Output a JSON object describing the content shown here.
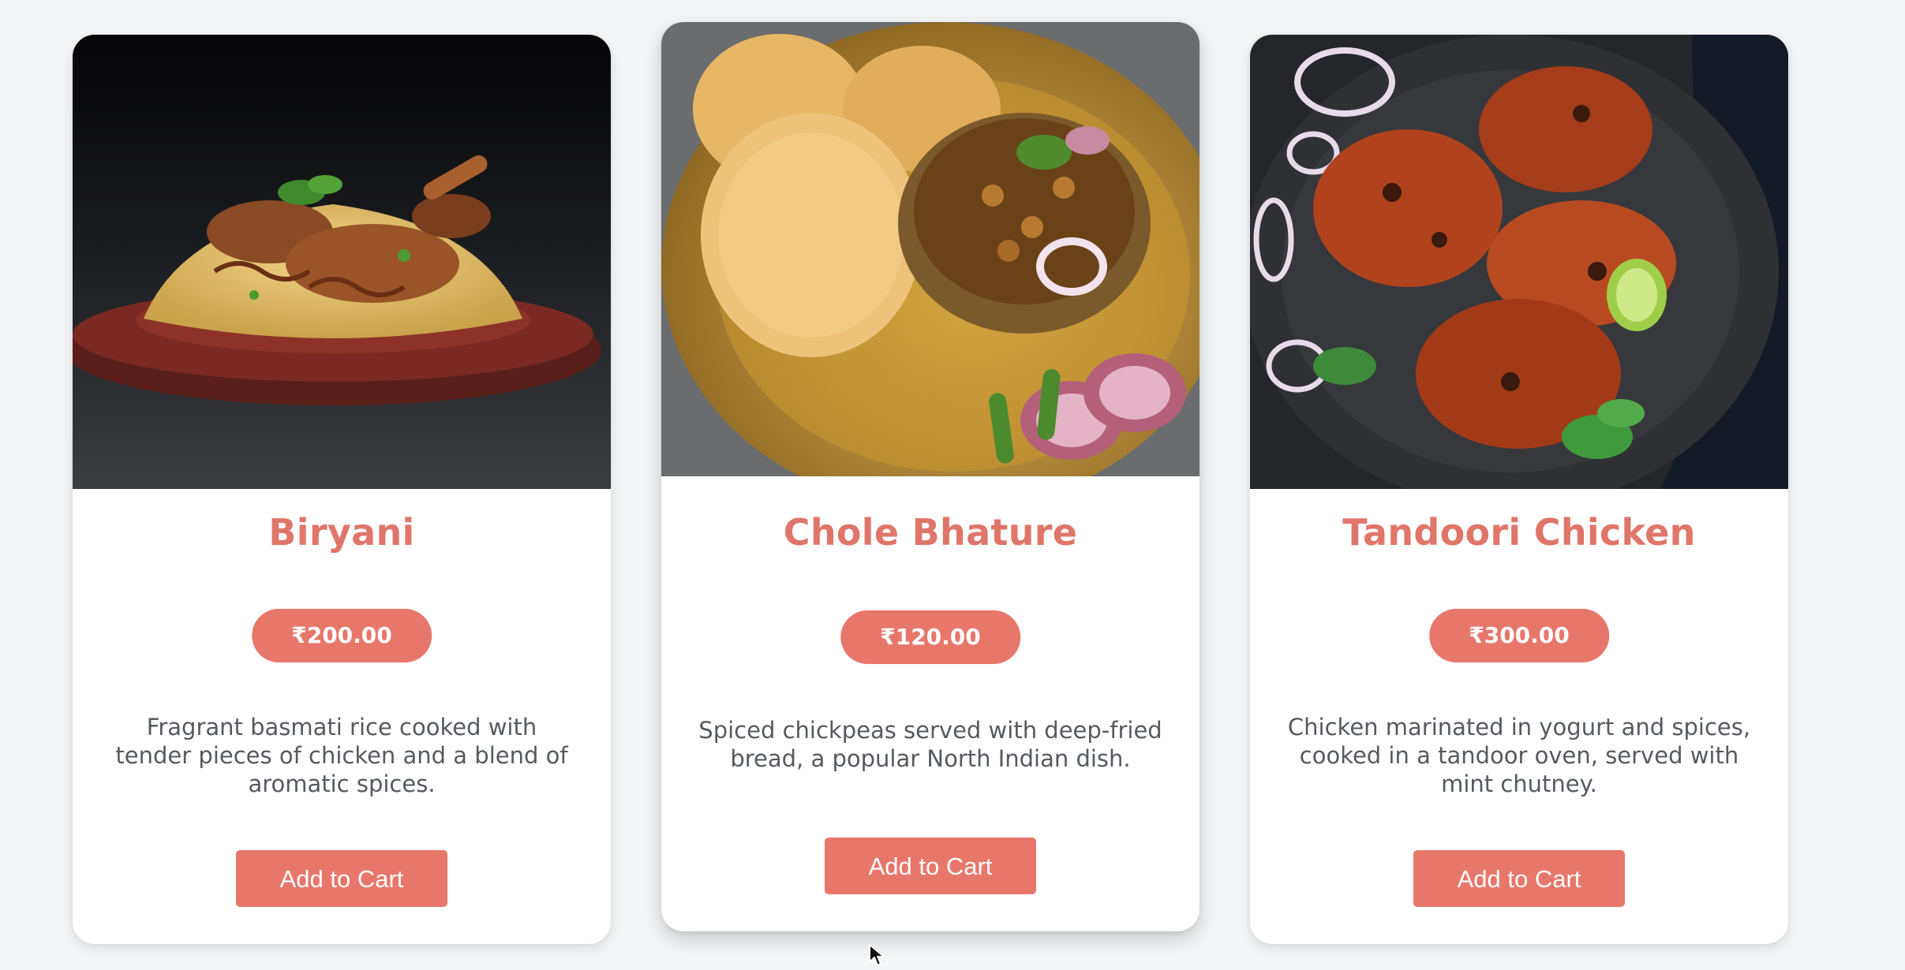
{
  "menu": {
    "items": [
      {
        "name": "Biryani",
        "price": "₹200.00",
        "description": "Fragrant basmati rice cooked with tender pieces of chicken and a blend of aromatic spices.",
        "button": "Add to Cart"
      },
      {
        "name": "Chole Bhature",
        "price": "₹120.00",
        "description": "Spiced chickpeas served with deep-fried bread, a popular North Indian dish.",
        "button": "Add to Cart"
      },
      {
        "name": "Tandoori Chicken",
        "price": "₹300.00",
        "description": "Chicken marinated in yogurt and spices, cooked in a tandoor oven, served with mint chutney.",
        "button": "Add to Cart"
      }
    ]
  },
  "colors": {
    "accent": "#e8776b",
    "title": "#e0756a",
    "text": "#555a60",
    "background": "#f4f5f7",
    "card": "#ffffff"
  },
  "icons": {
    "cursor": "mouse-pointer-icon"
  }
}
